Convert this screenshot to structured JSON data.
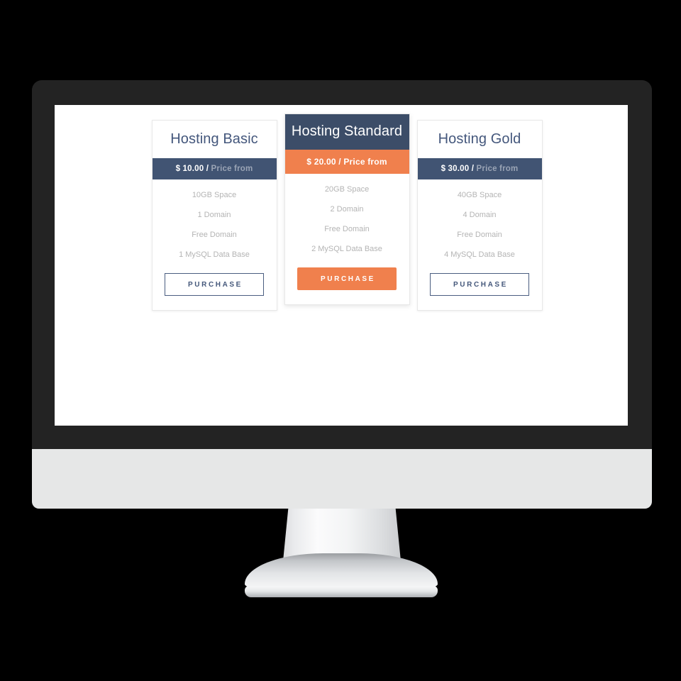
{
  "device": {
    "type": "desktop-monitor",
    "bezel_color": "#232323",
    "chin_color": "#e6e7e7",
    "background_color": "#000000"
  },
  "theme": {
    "navy": "#415473",
    "navy_dark": "#3c4d68",
    "orange": "#f0804d",
    "title_color": "#44577c",
    "feature_color": "#b4b4b4",
    "card_border": "#e8e8e8"
  },
  "pricing": {
    "plans": [
      {
        "id": "basic",
        "title": "Hosting Basic",
        "featured": false,
        "price_amount": "$ 10.00 /",
        "price_suffix": "Price from",
        "features": [
          "10GB Space",
          "1 Domain",
          "Free Domain",
          "1 MySQL Data Base"
        ],
        "cta_label": "PURCHASE"
      },
      {
        "id": "standard",
        "title": "Hosting Standard",
        "featured": true,
        "price_amount": "$ 20.00 /",
        "price_suffix": "Price from",
        "features": [
          "20GB Space",
          "2 Domain",
          "Free Domain",
          "2 MySQL Data Base"
        ],
        "cta_label": "PURCHASE"
      },
      {
        "id": "gold",
        "title": "Hosting Gold",
        "featured": false,
        "price_amount": "$ 30.00 /",
        "price_suffix": "Price from",
        "features": [
          "40GB Space",
          "4 Domain",
          "Free Domain",
          "4 MySQL Data Base"
        ],
        "cta_label": "PURCHASE"
      }
    ]
  }
}
